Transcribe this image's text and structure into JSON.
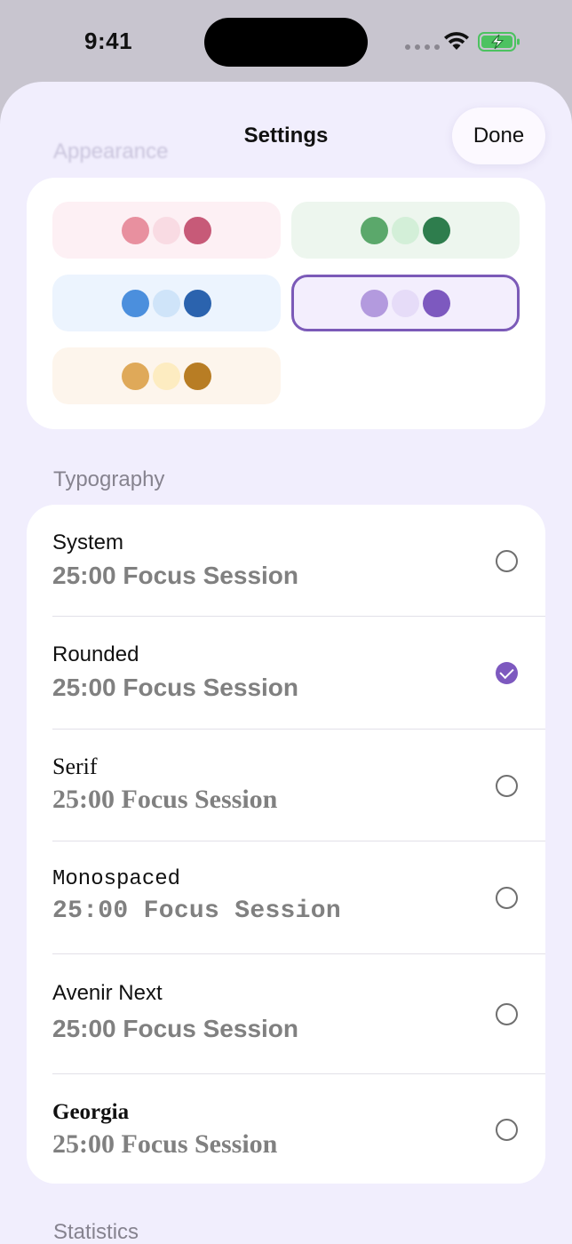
{
  "status_bar": {
    "time": "9:41"
  },
  "nav": {
    "title": "Settings",
    "done_label": "Done"
  },
  "sections": {
    "appearance": "Appearance",
    "typography": "Typography",
    "statistics": "Statistics"
  },
  "themes": [
    {
      "name": "pink",
      "bg": "#fdf0f4",
      "dots": [
        "#e8909f",
        "#f9dbe3",
        "#c75a78"
      ],
      "selected": false
    },
    {
      "name": "green",
      "bg": "#edf6ee",
      "dots": [
        "#5ba86b",
        "#d3efd8",
        "#2e7d4d"
      ],
      "selected": false
    },
    {
      "name": "blue",
      "bg": "#ecf4fe",
      "dots": [
        "#4b8fdd",
        "#cfe4f9",
        "#2b63ae"
      ],
      "selected": false
    },
    {
      "name": "purple",
      "bg": "#f3eefd",
      "dots": [
        "#b39ade",
        "#e6dcf8",
        "#7d59bf"
      ],
      "selected": true
    },
    {
      "name": "orange",
      "bg": "#fdf5ec",
      "dots": [
        "#dfa959",
        "#fdecc1",
        "#b87d24"
      ],
      "selected": false
    }
  ],
  "typography": {
    "options": [
      {
        "name": "System",
        "sample": "25:00 Focus Session",
        "selected": false
      },
      {
        "name": "Rounded",
        "sample": "25:00 Focus Session",
        "selected": true
      },
      {
        "name": "Serif",
        "sample": "25:00 Focus Session",
        "selected": false
      },
      {
        "name": "Monospaced",
        "sample": "25:00 Focus Session",
        "selected": false
      },
      {
        "name": "Avenir Next",
        "sample": "25:00 Focus Session",
        "selected": false
      },
      {
        "name": "Georgia",
        "sample": "25:00 Focus Session",
        "selected": false
      }
    ]
  },
  "colors": {
    "accent": "#7d59bf",
    "sheet_bg": "#f1eefd"
  }
}
